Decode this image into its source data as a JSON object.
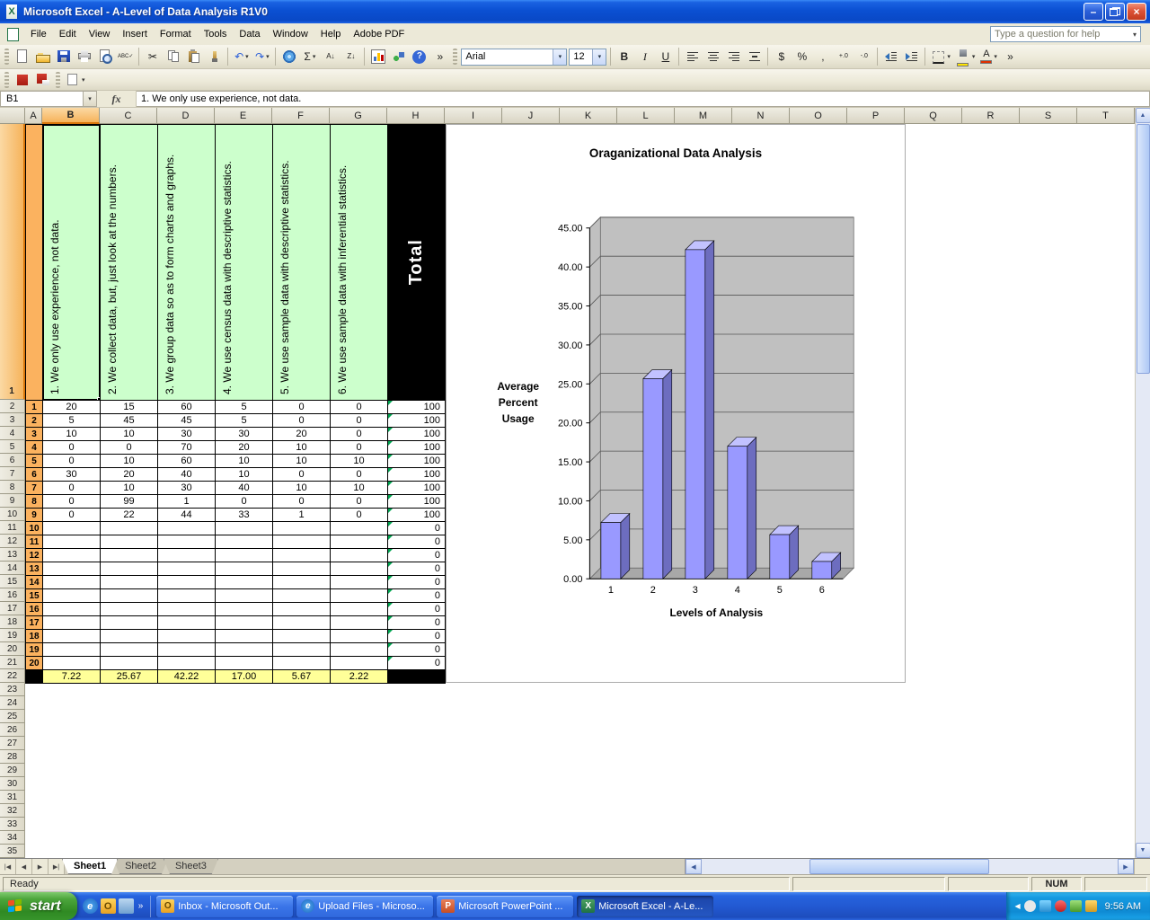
{
  "window": {
    "title": "Microsoft Excel - A-Level of Data Analysis R1V0"
  },
  "menu_bar": {
    "items": [
      {
        "label": "File"
      },
      {
        "label": "Edit"
      },
      {
        "label": "View"
      },
      {
        "label": "Insert"
      },
      {
        "label": "Format"
      },
      {
        "label": "Tools"
      },
      {
        "label": "Data"
      },
      {
        "label": "Window"
      },
      {
        "label": "Help"
      },
      {
        "label": "Adobe PDF"
      }
    ],
    "question_box": "Type a question for help"
  },
  "toolbars": {
    "standard": [
      {
        "grip": true
      },
      {
        "name": "new-workbook",
        "icon": "new"
      },
      {
        "name": "open",
        "icon": "open"
      },
      {
        "name": "save",
        "icon": "save"
      },
      {
        "name": "print",
        "icon": "print"
      },
      {
        "name": "print-preview",
        "icon": "preview"
      },
      {
        "name": "spelling",
        "glyph": "spelling",
        "gsize": 6
      },
      {
        "sep": true
      },
      {
        "name": "cut",
        "glyph": "cut"
      },
      {
        "name": "copy",
        "icon": "copy"
      },
      {
        "name": "paste",
        "icon": "paste"
      },
      {
        "name": "format-painter",
        "icon": "painter"
      },
      {
        "sep": true
      },
      {
        "name": "undo",
        "glyph": "undo",
        "gcolor": "#2b5fd9",
        "drop": true
      },
      {
        "name": "redo",
        "glyph": "redo",
        "gcolor": "#2b5fd9",
        "drop": true
      },
      {
        "sep": true
      },
      {
        "name": "insert-hyperlink",
        "icon": "hyperlink"
      },
      {
        "name": "autosum",
        "glyph": "sum",
        "drop": true
      },
      {
        "name": "sort-ascending",
        "glyph": "sort_asc",
        "gsize": 8
      },
      {
        "name": "sort-descending",
        "glyph": "sort_desc",
        "gsize": 8
      },
      {
        "sep": true
      },
      {
        "name": "chart-wizard",
        "icon": "chart"
      },
      {
        "name": "drawing",
        "icon": "drawing"
      },
      {
        "name": "help",
        "glyph": "help",
        "wrap": "circle"
      },
      {
        "name": "toolbar-options",
        "glyph": "chevron"
      }
    ],
    "formatting": [
      {
        "grip": true
      },
      {
        "combo": true,
        "name": "font",
        "value": "Arial",
        "width": 118
      },
      {
        "combo": true,
        "name": "font-size",
        "value": "12",
        "width": 42
      },
      {
        "sep": true
      },
      {
        "name": "bold",
        "glyph": "bold",
        "cls": "g-bold"
      },
      {
        "name": "italic",
        "glyph": "italic",
        "cls": "g-italic"
      },
      {
        "name": "underline",
        "glyph": "underline",
        "cls": "g-underline"
      },
      {
        "sep": true
      },
      {
        "name": "align-left",
        "icon": "align-left"
      },
      {
        "name": "align-center",
        "icon": "align-center"
      },
      {
        "name": "align-right",
        "icon": "align-right"
      },
      {
        "name": "merge-center",
        "icon": "merge"
      },
      {
        "sep": true
      },
      {
        "name": "currency",
        "glyph": "currency"
      },
      {
        "name": "percent",
        "glyph": "percent"
      },
      {
        "name": "comma",
        "glyph": "comma"
      },
      {
        "name": "increase-decimal",
        "glyph": "inc_decimal",
        "gsize": 7
      },
      {
        "name": "decrease-decimal",
        "glyph": "dec_decimal",
        "gsize": 7
      },
      {
        "sep": true
      },
      {
        "name": "decrease-indent",
        "icon": "dec-indent"
      },
      {
        "name": "increase-indent",
        "icon": "inc-indent"
      },
      {
        "sep": true
      },
      {
        "name": "borders",
        "icon": "borders",
        "drop": true
      },
      {
        "name": "fill-color",
        "icon": "bucket",
        "bar": "#FFE400",
        "drop": true
      },
      {
        "name": "font-color",
        "glyph": "font_a",
        "bar": "#E03000",
        "drop": true
      },
      {
        "name": "toolbar-options",
        "glyph": "chevron"
      }
    ],
    "secondary": [
      {
        "grip": true
      },
      {
        "name": "adobe-create-pdf",
        "icon": "pdf"
      },
      {
        "name": "adobe-email-pdf",
        "icon": "pdf-mail"
      },
      {
        "grip": true
      },
      {
        "name": "adobe-review",
        "icon": "pdf-review",
        "drop": true
      }
    ]
  },
  "formula_bar": {
    "cell_reference": "B1",
    "formula": "1. We only use experience, not data."
  },
  "sheet": {
    "columns": [
      "A",
      "B",
      "C",
      "D",
      "E",
      "F",
      "G",
      "H",
      "I",
      "J",
      "K",
      "L",
      "M",
      "N",
      "O",
      "P",
      "Q",
      "R",
      "S",
      "T"
    ],
    "visible_rows": 35,
    "selected_column": "B",
    "selected_row": 1,
    "category_headers": [
      "1. We only use experience, not data.",
      "2. We collect data, but, just look at the numbers.",
      "3. We group data so as to form charts and graphs.",
      "4. We use census data with descriptive statistics.",
      "5. We use sample data with descriptive statistics.",
      "6. We use sample data with inferential statistics."
    ],
    "total_header": "Total",
    "data_rows": [
      {
        "id": "1",
        "values": [
          "20",
          "15",
          "60",
          "5",
          "0",
          "0"
        ],
        "total": "100"
      },
      {
        "id": "2",
        "values": [
          "5",
          "45",
          "45",
          "5",
          "0",
          "0"
        ],
        "total": "100"
      },
      {
        "id": "3",
        "values": [
          "10",
          "10",
          "30",
          "30",
          "20",
          "0"
        ],
        "total": "100"
      },
      {
        "id": "4",
        "values": [
          "0",
          "0",
          "70",
          "20",
          "10",
          "0"
        ],
        "total": "100"
      },
      {
        "id": "5",
        "values": [
          "0",
          "10",
          "60",
          "10",
          "10",
          "10"
        ],
        "total": "100"
      },
      {
        "id": "6",
        "values": [
          "30",
          "20",
          "40",
          "10",
          "0",
          "0"
        ],
        "total": "100"
      },
      {
        "id": "7",
        "values": [
          "0",
          "10",
          "30",
          "40",
          "10",
          "10"
        ],
        "total": "100"
      },
      {
        "id": "8",
        "values": [
          "0",
          "99",
          "1",
          "0",
          "0",
          "0"
        ],
        "total": "100"
      },
      {
        "id": "9",
        "values": [
          "0",
          "22",
          "44",
          "33",
          "1",
          "0"
        ],
        "total": "100"
      },
      {
        "id": "10",
        "values": [
          "",
          "",
          "",
          "",
          "",
          ""
        ],
        "total": "0"
      },
      {
        "id": "11",
        "values": [
          "",
          "",
          "",
          "",
          "",
          ""
        ],
        "total": "0"
      },
      {
        "id": "12",
        "values": [
          "",
          "",
          "",
          "",
          "",
          ""
        ],
        "total": "0"
      },
      {
        "id": "13",
        "values": [
          "",
          "",
          "",
          "",
          "",
          ""
        ],
        "total": "0"
      },
      {
        "id": "14",
        "values": [
          "",
          "",
          "",
          "",
          "",
          ""
        ],
        "total": "0"
      },
      {
        "id": "15",
        "values": [
          "",
          "",
          "",
          "",
          "",
          ""
        ],
        "total": "0"
      },
      {
        "id": "16",
        "values": [
          "",
          "",
          "",
          "",
          "",
          ""
        ],
        "total": "0"
      },
      {
        "id": "17",
        "values": [
          "",
          "",
          "",
          "",
          "",
          ""
        ],
        "total": "0"
      },
      {
        "id": "18",
        "values": [
          "",
          "",
          "",
          "",
          "",
          ""
        ],
        "total": "0"
      },
      {
        "id": "19",
        "values": [
          "",
          "",
          "",
          "",
          "",
          ""
        ],
        "total": "0"
      },
      {
        "id": "20",
        "values": [
          "",
          "",
          "",
          "",
          "",
          ""
        ],
        "total": "0"
      }
    ],
    "average_row": [
      "7.22",
      "25.67",
      "42.22",
      "17.00",
      "5.67",
      "2.22"
    ]
  },
  "chart_data": {
    "type": "bar",
    "style": "3d-column",
    "title": "Oraganizational Data Analysis",
    "categories": [
      "1",
      "2",
      "3",
      "4",
      "5",
      "6"
    ],
    "values": [
      7.22,
      25.67,
      42.22,
      17.0,
      5.67,
      2.22
    ],
    "xlabel": "Levels of Analysis",
    "ylabel": "Average Percent Usage",
    "ylim": [
      0,
      45
    ],
    "ytick_step": 5,
    "grid": true,
    "legend": false,
    "bar_color": "#9999ff",
    "bar_top_color": "#c2c2ff",
    "bar_side_color": "#6d6dbf",
    "wall_color": "#c0c0c0",
    "floor_color": "#a8a8a8"
  },
  "tab_bar": {
    "tabs": [
      {
        "label": "Sheet1",
        "active": true
      },
      {
        "label": "Sheet2",
        "active": false
      },
      {
        "label": "Sheet3",
        "active": false
      }
    ]
  },
  "status_bar": {
    "mode": "Ready",
    "keyboard": "NUM"
  },
  "taskbar": {
    "start_label": "start",
    "clock": "9:56 AM",
    "tasks": [
      {
        "label": "Inbox - Microsoft Out...",
        "icon": "outlook",
        "active": false
      },
      {
        "label": "Upload Files - Microso...",
        "icon": "ie",
        "active": false
      },
      {
        "label": "Microsoft PowerPoint ...",
        "icon": "powerpoint",
        "active": false
      },
      {
        "label": "Microsoft Excel - A-Le...",
        "icon": "excel",
        "active": true
      }
    ]
  },
  "glyphs": {
    "minimize": "–",
    "close": "×",
    "dropdown": "▾",
    "chevron": "»",
    "fx": "fx",
    "cut": "✂",
    "spelling": "ABC✓",
    "undo": "↶",
    "redo": "↷",
    "sum": "Σ",
    "sort_asc": "A↓",
    "sort_desc": "Z↓",
    "help": "?",
    "bold": "B",
    "italic": "I",
    "underline": "U",
    "currency": "$",
    "percent": "%",
    "comma": ",",
    "inc_decimal": "+.0",
    "dec_decimal": "-.0",
    "font_a": "A",
    "up_arrow": "▲",
    "down_arrow": "▼",
    "left_arrow": "◀",
    "right_arrow": "▶",
    "tab_first": "|◀",
    "tab_prev": "◀",
    "tab_next": "▶",
    "tab_last": "▶|",
    "outlook": "O",
    "ie": "e",
    "powerpoint": "P",
    "excel": "X"
  }
}
